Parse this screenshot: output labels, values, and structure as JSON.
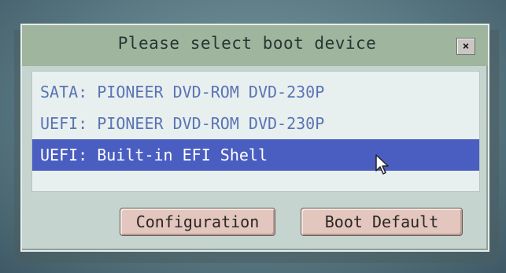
{
  "dialog": {
    "title": "Please select boot device",
    "close_glyph": "×"
  },
  "boot_devices": [
    {
      "label": "SATA: PIONEER DVD-ROM DVD-230P",
      "selected": false
    },
    {
      "label": "UEFI: PIONEER DVD-ROM DVD-230P",
      "selected": false
    },
    {
      "label": "UEFI: Built-in EFI Shell",
      "selected": true
    }
  ],
  "buttons": {
    "configuration": "Configuration",
    "boot_default": "Boot Default"
  },
  "colors": {
    "selection": "#4a5ec1",
    "item_text": "#5a74b4",
    "button_face": "#e3c6bd",
    "titlebar": "#9fb59e"
  },
  "icons": {
    "close": "close-icon",
    "pointer": "mouse-pointer-icon"
  }
}
